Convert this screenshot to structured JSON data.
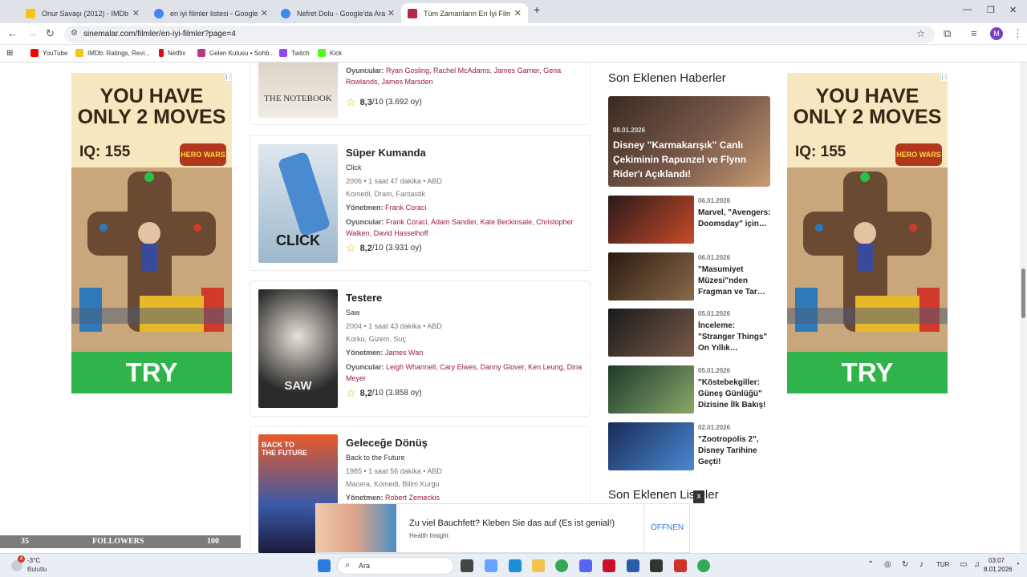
{
  "browser": {
    "tabs": [
      {
        "label": "Onur Savaşı (2012) - IMDb",
        "color": "#f5c518"
      },
      {
        "label": "en iyi filmler listesi - Google'da",
        "color": "#4285f4"
      },
      {
        "label": "Nefret Dolu - Google'da Ara",
        "color": "#4285f4"
      },
      {
        "label": "Tüm Zamanların En İyi Filmleri",
        "color": "#b3284c"
      }
    ],
    "new_tab": "+",
    "url": "sinemalar.com/filmler/en-iyi-filmler?page=4",
    "profile": "M",
    "bookmarks": [
      {
        "label": "YouTube",
        "color": "#ff0000"
      },
      {
        "label": "IMDb: Ratings, Revi...",
        "color": "#f5c518"
      },
      {
        "label": "Netflix",
        "color": "#e50914"
      },
      {
        "label": "Gelen Kutusu • Sohb...",
        "color": "#c13584"
      },
      {
        "label": "Twitch",
        "color": "#9146ff"
      },
      {
        "label": "Kick",
        "color": "#53fc18"
      }
    ]
  },
  "ads": {
    "headline": "YOU HAVE ONLY 2 MOVES",
    "iq": "IQ: 155",
    "brand": "HERO WARS",
    "cta": "TRY",
    "badge": "i ⁝"
  },
  "partial_movie": {
    "cast_label": "Oyuncular:",
    "cast": "Ryan Gosling, Rachel McAdams, James Garner, Gena Rowlands, James Marsden",
    "score": "8,3",
    "score_suffix": "/10 (3.692 oy)",
    "poster_text": "THE NOTEBOOK"
  },
  "movies": [
    {
      "title": "Süper Kumanda",
      "original": "Click",
      "meta": "2006 • 1 saat 47 dakika • ABD",
      "genres": "Komedi, Dram, Fantastik",
      "director_label": "Yönetmen:",
      "director": "Frank Coraci",
      "cast_label": "Oyuncular:",
      "cast": "Frank Coraci, Adam Sandler, Kate Beckinsale, Christopher Walken, David Hasselhoff",
      "score": "8,2",
      "score_suffix": "/10 (3.931 oy)",
      "poster_text": "CLICK"
    },
    {
      "title": "Testere",
      "original": "Saw",
      "meta": "2004 • 1 saat 43 dakika • ABD",
      "genres": "Korku, Gizem, Suç",
      "director_label": "Yönetmen:",
      "director": "James Wan",
      "cast_label": "Oyuncular:",
      "cast": "Leigh Whannell, Cary Elwes, Danny Glover, Ken Leung, Dina Meyer",
      "score": "8,2",
      "score_suffix": "/10 (3.858 oy)",
      "poster_text": "SAW"
    },
    {
      "title": "Geleceğe Dönüş",
      "original": "Back to the Future",
      "meta": "1985 • 1 saat 56 dakika • ABD",
      "genres": "Macera, Komedi, Bilim Kurgu",
      "director_label": "Yönetmen:",
      "director": "Robert Zemeckis",
      "poster_text": "BACK TO THE FUTURE"
    }
  ],
  "news": {
    "heading": "Son Eklenen Haberler",
    "hero": {
      "date": "08.01.2026",
      "title": "Disney \"Karmakarışık\" Canlı Çekiminin Rapunzel ve Flynn Rider'ı Açıklandı!"
    },
    "items": [
      {
        "date": "06.01.2026",
        "title": "Marvel, \"Avengers: Doomsday\" için…",
        "color": "#8a2a1a"
      },
      {
        "date": "06.01.2026",
        "title": "\"Masumiyet Müzesi\"nden Fragman ve Tar…",
        "color": "#5a3a22"
      },
      {
        "date": "05.01.2026",
        "title": "İnceleme: \"Stranger Things\" On Yıllık…",
        "color": "#4a3a3a"
      },
      {
        "date": "05.01.2026",
        "title": "\"Köstebekgiller: Güneş Günlüğü\" Dizisine İlk Bakış!",
        "color": "#3a6a4a"
      },
      {
        "date": "02.01.2026",
        "title": "\"Zootropolis 2\", Disney Tarihine Geçti!",
        "color": "#2a4a8a"
      }
    ],
    "lists_heading": "Son Eklenen Listeler"
  },
  "bottom_ad": {
    "title": "Zu viel Bauchfett? Kleben Sie das auf (Es ist genial!)",
    "source": "Health Insight",
    "button": "ÖFFNEN",
    "close": "x"
  },
  "followers": {
    "left": "35",
    "label": "FOLLOWERS",
    "right": "100"
  },
  "taskbar": {
    "temp": "-3°C",
    "weather": "Bulutlu",
    "badge": "4",
    "search": "Ara",
    "lang": "TUR",
    "time": "03:07",
    "date": "8.01.2026"
  }
}
